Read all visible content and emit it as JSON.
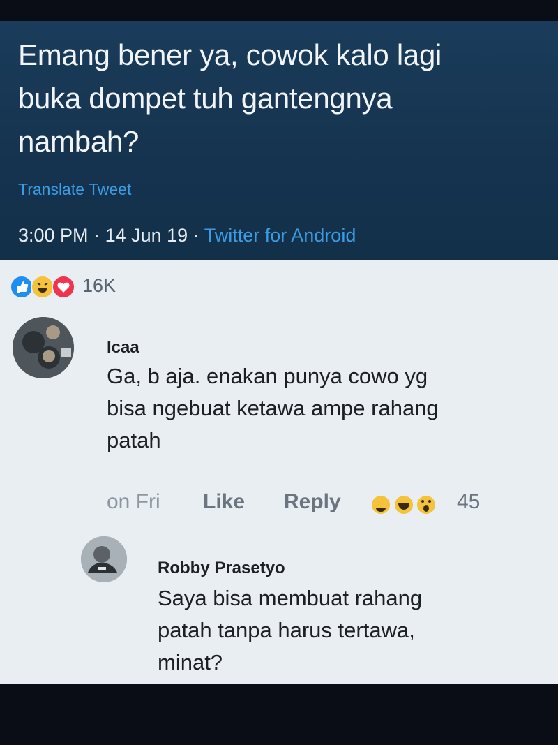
{
  "tweet": {
    "text_line1": "Emang bener ya, cowok kalo lagi",
    "text_line2": "buka dompet tuh gantengnya",
    "text_line3": "nambah?",
    "translate": "Translate Tweet",
    "time": "3:00 PM",
    "date": "14 Jun 19",
    "source": "Twitter for Android",
    "sep": "·"
  },
  "post": {
    "reaction_count": "16K",
    "reaction_icons": [
      "like-icon",
      "haha-icon",
      "love-icon"
    ]
  },
  "comments": [
    {
      "name": "Icaa",
      "line1": "Ga, b aja. enakan punya cowo yg",
      "line2": "bisa ngebuat ketawa ampe rahang",
      "line3": "patah",
      "time": "on Fri",
      "like_label": "Like",
      "reply_label": "Reply",
      "reaction_count": "45"
    },
    {
      "name": "Robby Prasetyo",
      "line1": "Saya bisa membuat rahang",
      "line2": "patah tanpa harus tertawa,",
      "line3": "minat?"
    }
  ],
  "colors": {
    "tweet_bg": "#15334f",
    "link_blue": "#3b9be3",
    "fb_bg": "#e9eef3"
  }
}
